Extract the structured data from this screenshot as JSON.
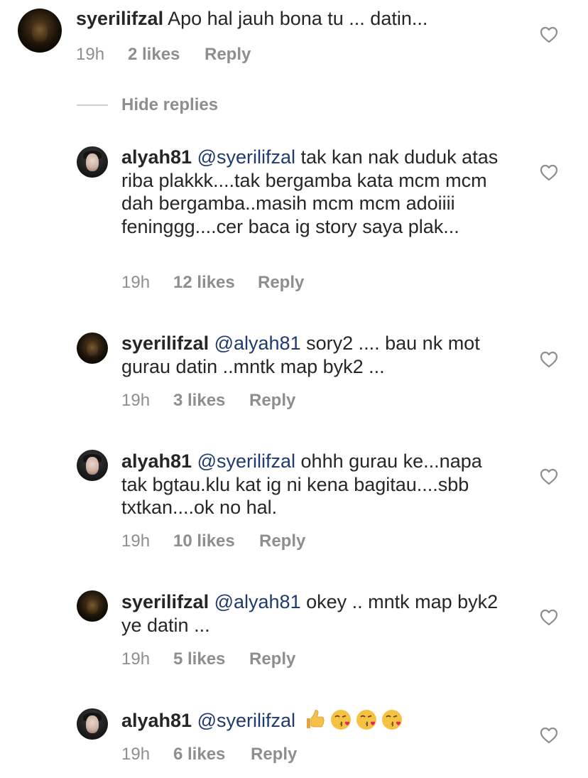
{
  "thread": {
    "parent": {
      "username": "syerilifzal",
      "text": "Apo hal jauh bona tu ... datin...",
      "time": "19h",
      "likes": "2 likes",
      "reply": "Reply",
      "avatar": "syerilifzal-avatar"
    },
    "hide_replies": "Hide replies",
    "replies": [
      {
        "username": "alyah81",
        "mention": "@syerilifzal",
        "text": " tak kan nak duduk atas riba plakkk....tak bergamba kata mcm mcm dah bergamba..masih mcm mcm adoiiii feninggg....cer baca ig story saya plak...",
        "time": "19h",
        "likes": "12 likes",
        "reply": "Reply"
      },
      {
        "username": "syerilifzal",
        "mention": "@alyah81",
        "text": " sory2 .... bau nk mot gurau datin ..mntk map byk2 ...",
        "time": "19h",
        "likes": "3 likes",
        "reply": "Reply"
      },
      {
        "username": "alyah81",
        "mention": "@syerilifzal",
        "text": " ohhh gurau ke...napa tak bgtau.klu kat ig ni kena bagitau....sbb txtkan....ok no hal.",
        "time": "19h",
        "likes": "10 likes",
        "reply": "Reply"
      },
      {
        "username": "syerilifzal",
        "mention": "@alyah81",
        "text": " okey .. mntk map byk2 ye datin ...",
        "time": "19h",
        "likes": "5 likes",
        "reply": "Reply"
      },
      {
        "username": "alyah81",
        "mention": "@syerilifzal",
        "text": "",
        "emojis": [
          "thumbs-up-emoji",
          "face-blowing-kiss-emoji",
          "face-blowing-kiss-emoji",
          "face-blowing-kiss-emoji"
        ],
        "time": "19h",
        "likes": "6 likes",
        "reply": "Reply"
      }
    ]
  },
  "icons": {
    "like": "heart-outline-icon"
  },
  "colors": {
    "text": "#262626",
    "meta": "#8e8e8e",
    "mention": "#1e3a6e",
    "divider": "#cfcfcf"
  }
}
